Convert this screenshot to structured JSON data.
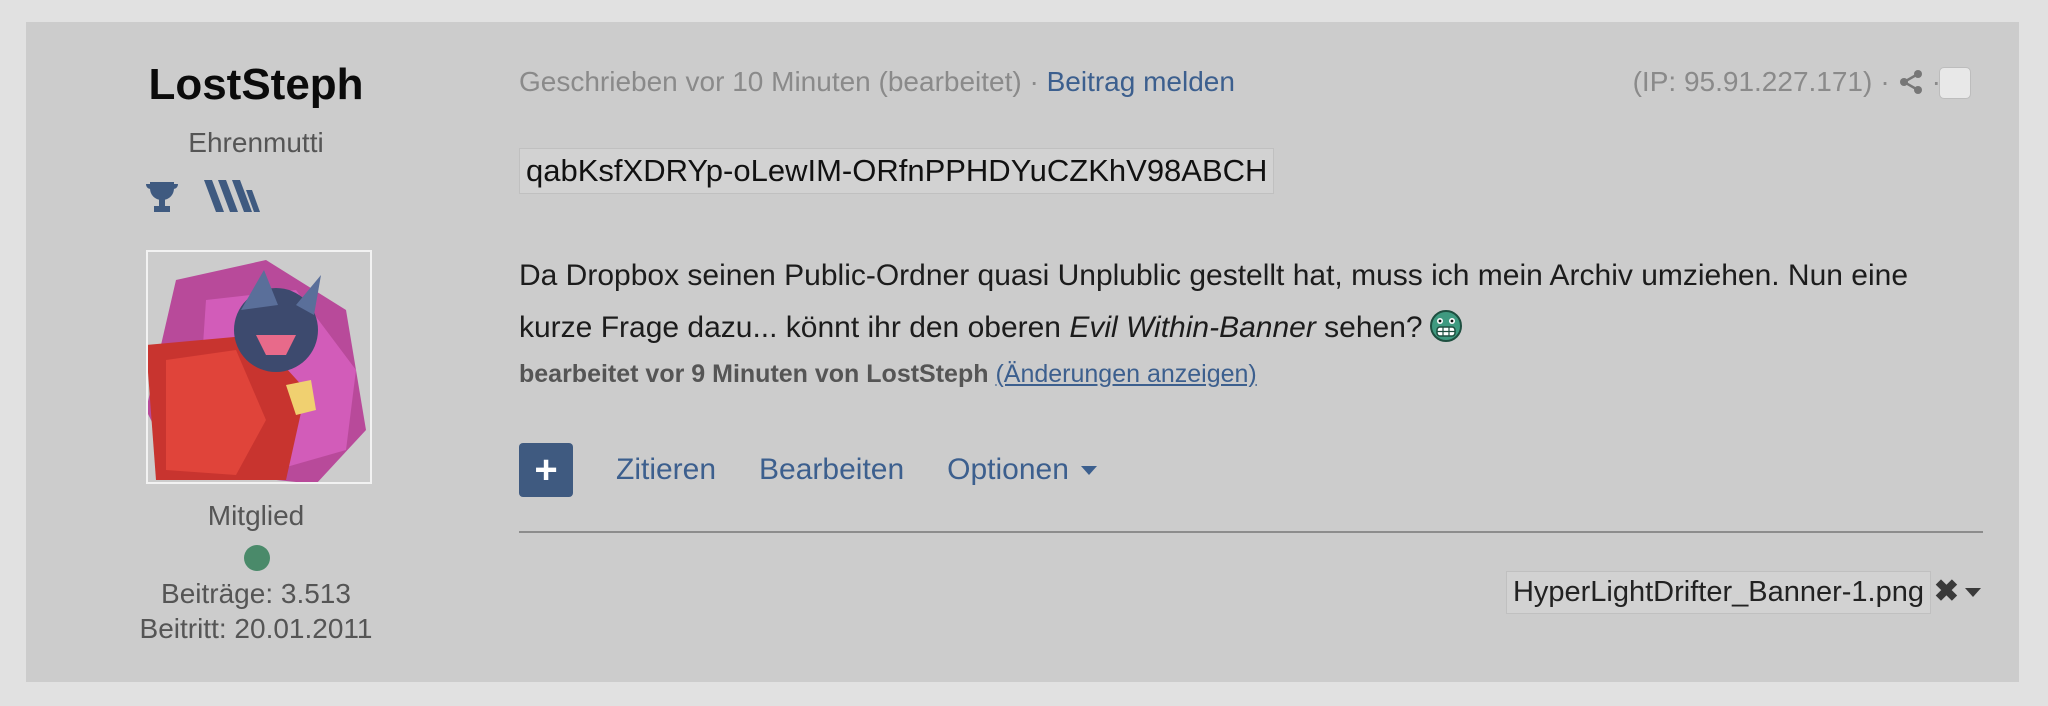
{
  "author": {
    "name": "LostSteph",
    "title": "Ehrenmutti",
    "group": "Mitglied",
    "posts": "Beiträge: 3.513",
    "joined": "Beitritt: 20.01.2011",
    "online_color": "#4a8a6a",
    "badges": [
      "trophy-icon",
      "stripes-icon"
    ]
  },
  "meta": {
    "written": "Geschrieben vor 10 Minuten (bearbeitet)",
    "separator": " · ",
    "report_link": "Beitrag melden",
    "ip": "(IP: 95.91.227.171)",
    "dot1": "·",
    "dot2": "·"
  },
  "post": {
    "code": "qabKsfXDRYp-oLewIM-ORfnPPHDYuCZKhV98ABCH",
    "text_before": "Da Dropbox seinen Public-Ordner quasi Unplublic gestellt hat, muss ich mein Archiv umziehen. Nun eine kurze Frage dazu... könnt ihr den oberen ",
    "text_emph": "Evil Within-Banner",
    "text_after": " sehen?",
    "emoji": "grin-emoji",
    "edited_by": "bearbeitet vor 9 Minuten von LostSteph",
    "show_changes": "(Änderungen anzeigen)"
  },
  "actions": {
    "plus": "+",
    "quote": "Zitieren",
    "edit": "Bearbeiten",
    "options": "Optionen"
  },
  "attachment": {
    "filename": "HyperLightDrifter_Banner-1.png",
    "remove": "✖"
  },
  "colors": {
    "accent": "#3c5f8e",
    "button": "#3f5a80",
    "background": "#cccccc"
  }
}
